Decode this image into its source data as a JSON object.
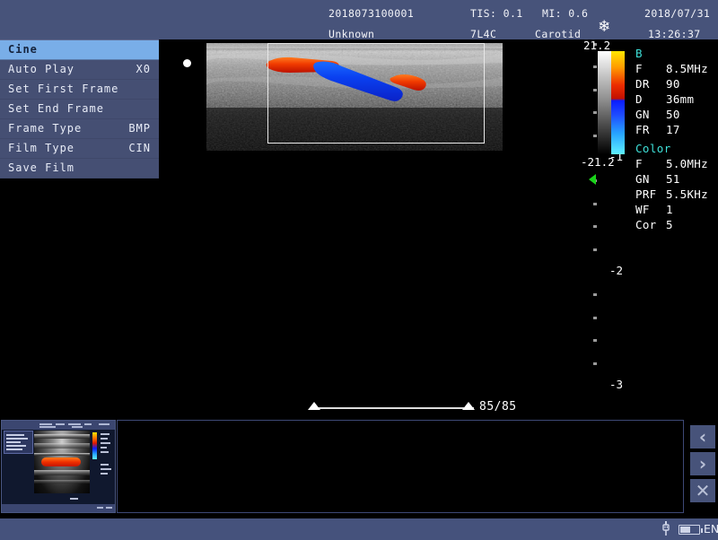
{
  "header": {
    "patient_id": "2018073100001",
    "patient_name": "Unknown",
    "tis": "TIS: 0.1",
    "mi": "MI: 0.6",
    "probe": "7L4C",
    "exam_type": "Carotid",
    "date": "2018/07/31",
    "time": "13:26:37",
    "freeze_icon": "freeze-snowflake-icon"
  },
  "menu": {
    "items": [
      {
        "label": "Cine",
        "value": "",
        "selected": true
      },
      {
        "label": "Auto Play",
        "value": "X0",
        "selected": false
      },
      {
        "label": "Set First Frame",
        "value": "",
        "selected": false
      },
      {
        "label": "Set End Frame",
        "value": "",
        "selected": false
      },
      {
        "label": "Frame Type",
        "value": "BMP",
        "selected": false
      },
      {
        "label": "Film Type",
        "value": "CIN",
        "selected": false
      },
      {
        "label": "Save Film",
        "value": "",
        "selected": false
      }
    ]
  },
  "image": {
    "orientation_marker": "orientation-dot",
    "roi_label": "color-doppler-roi-box"
  },
  "cine": {
    "counter": "85/85",
    "start_marker": "cine-start-marker",
    "end_marker": "cine-end-marker"
  },
  "colorbar": {
    "top_value": "21.2",
    "bottom_value": "-21.2"
  },
  "ruler": {
    "labels": [
      "-1",
      "-2",
      "-3"
    ],
    "focus_marker": "focus-zone-marker"
  },
  "params": {
    "b_title": "B",
    "b_rows": [
      {
        "key": "F",
        "value": "8.5MHz"
      },
      {
        "key": "DR",
        "value": "90"
      },
      {
        "key": "D",
        "value": "36mm"
      },
      {
        "key": "GN",
        "value": "50"
      },
      {
        "key": "FR",
        "value": "17"
      }
    ],
    "color_title": "Color",
    "color_rows": [
      {
        "key": "F",
        "value": "5.0MHz"
      },
      {
        "key": "GN",
        "value": "51"
      },
      {
        "key": "PRF",
        "value": "5.5KHz"
      },
      {
        "key": "WF",
        "value": "1"
      },
      {
        "key": "Cor",
        "value": "5"
      }
    ]
  },
  "strip": {
    "thumbnail_label": "cine-thumbnail-1",
    "nav_prev": "‹",
    "nav_next": "›",
    "nav_close": "✕"
  },
  "status": {
    "usb_icon": "usb-icon",
    "battery_icon": "battery-icon",
    "language": "EN"
  },
  "colors": {
    "header_bg": "#47537a",
    "menu_bg": "#454f73",
    "menu_selected": "#79aee8",
    "group_title": "#3ee0d8",
    "focus_green": "#19d219",
    "canvas_bg": "#000000"
  }
}
